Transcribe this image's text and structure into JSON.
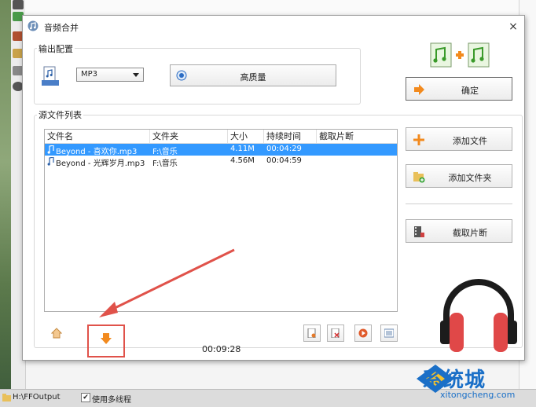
{
  "background": {
    "status_path": "H:\\FFOutput",
    "multithread_label": "使用多线程",
    "multithread_checked": true
  },
  "dialog": {
    "title": "音频合并",
    "close_glyph": "×"
  },
  "output_config": {
    "group_label": "输出配置",
    "format": "MP3",
    "quality_label": "高质量"
  },
  "buttons": {
    "confirm": "确定",
    "add_file": "添加文件",
    "add_folder": "添加文件夹",
    "cut_clip": "截取片断"
  },
  "source_list": {
    "group_label": "源文件列表",
    "columns": [
      "文件名",
      "文件夹",
      "大小",
      "持续时间",
      "截取片断"
    ],
    "rows": [
      {
        "name": "Beyond - 喜欢你.mp3",
        "folder": "F:\\音乐",
        "size": "4.11M",
        "duration": "00:04:29",
        "clip": "",
        "selected": true
      },
      {
        "name": "Beyond - 光辉岁月.mp3",
        "folder": "F:\\音乐",
        "size": "4.56M",
        "duration": "00:04:59",
        "clip": "",
        "selected": false
      }
    ],
    "total_time": "00:09:28"
  },
  "watermark": {
    "brand": "系统城",
    "url": "xitongcheng.com"
  },
  "colors": {
    "selection": "#3399ff",
    "accent_orange": "#f28a1e",
    "annotation_red": "#e0524a",
    "headphone_red": "#e04848"
  }
}
